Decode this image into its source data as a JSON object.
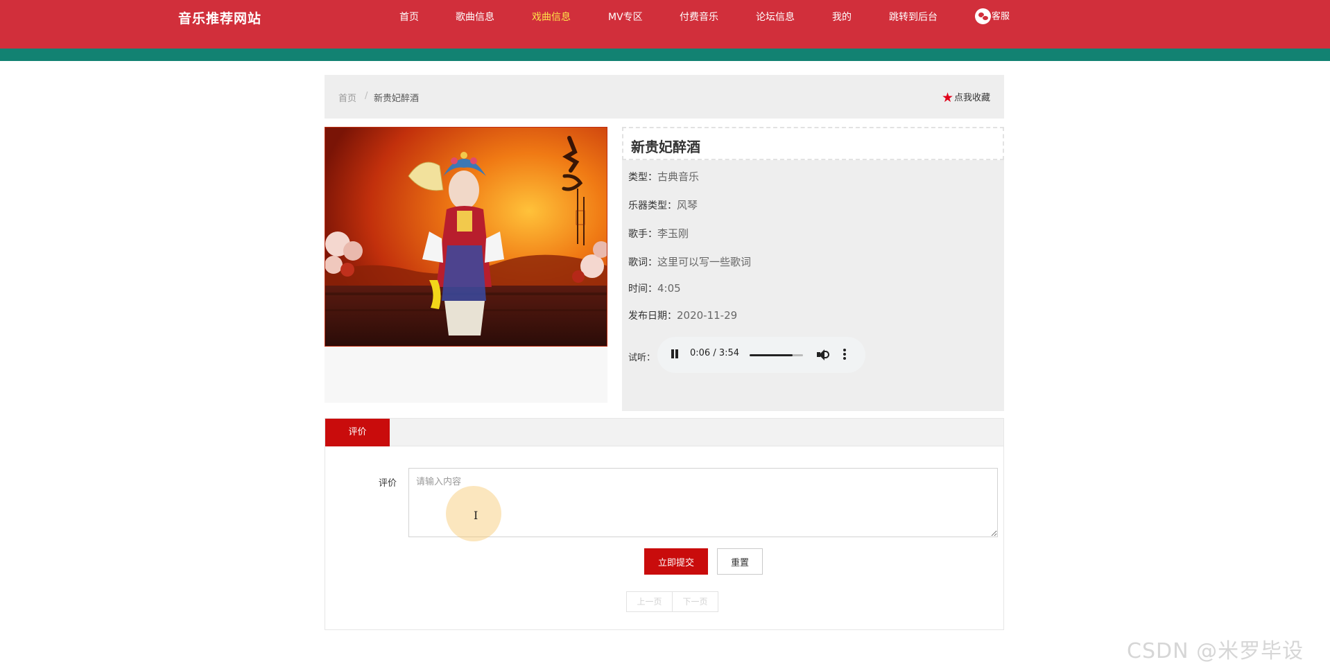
{
  "header": {
    "site_title": "音乐推荐网站",
    "nav": [
      {
        "label": "首页"
      },
      {
        "label": "歌曲信息"
      },
      {
        "label": "戏曲信息",
        "active": true
      },
      {
        "label": "MV专区"
      },
      {
        "label": "付费音乐"
      },
      {
        "label": "论坛信息"
      },
      {
        "label": "我的"
      },
      {
        "label": "跳转到后台"
      },
      {
        "label": "客服",
        "icon": "wechat-icon"
      }
    ],
    "colors": {
      "bar": "#d12f3b",
      "stripe": "#128272",
      "active_nav": "#ffe24a"
    }
  },
  "breadcrumb": {
    "home": "首页",
    "separator": "/",
    "current": "新贵妃醉酒",
    "favorite_label": "点我收藏"
  },
  "detail": {
    "title": "新贵妃醉酒",
    "fields": [
      {
        "label": "类型：",
        "value": "古典音乐"
      },
      {
        "label": "乐器类型：",
        "value": "风琴"
      },
      {
        "label": "歌手：",
        "value": "李玉刚"
      },
      {
        "label": "歌词：",
        "value": "这里可以写一些歌词"
      },
      {
        "label": "时间：",
        "value": "4:05"
      },
      {
        "label": "发布日期：",
        "value": "2020-11-29"
      }
    ],
    "listen_label": "试听：",
    "player": {
      "time": "0:06 / 3:54",
      "volume": 0.8
    }
  },
  "review": {
    "tab_label": "评价",
    "field_label": "评价",
    "placeholder": "请输入内容",
    "submit_label": "立即提交",
    "reset_label": "重置",
    "prev_label": "上一页",
    "next_label": "下一页"
  },
  "watermark": "CSDN @米罗毕设"
}
